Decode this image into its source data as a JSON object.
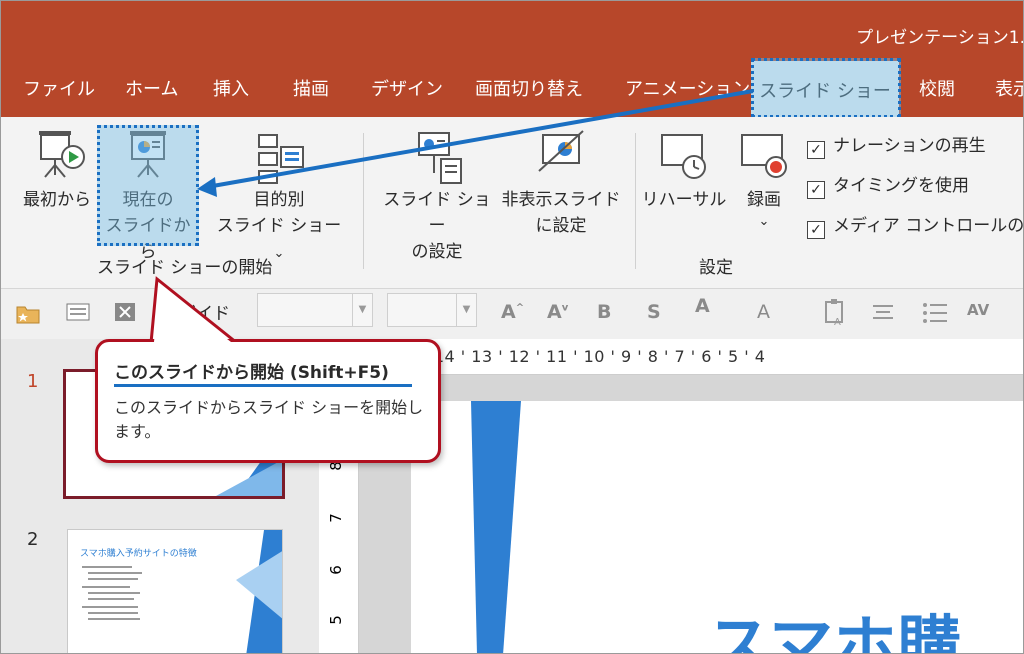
{
  "app": {
    "title": "プレゼンテーション1."
  },
  "tabs": [
    "ファイル",
    "ホーム",
    "挿入",
    "描画",
    "デザイン",
    "画面切り替え",
    "アニメーション",
    "スライド ショー",
    "校閲",
    "表示"
  ],
  "active_tab": "スライド ショー",
  "ribbon": {
    "start_group": {
      "label": "スライド ショーの開始",
      "from_beginning": "最初から",
      "from_current_line1": "現在の",
      "from_current_line2": "スライドから",
      "custom_line1": "目的別",
      "custom_line2": "スライド ショー",
      "custom_caret": "⌄"
    },
    "setup_group": {
      "label": "設定",
      "setup_line1": "スライド ショー",
      "setup_line2": "の設定",
      "hide_line1": "非表示スライド",
      "hide_line2": "に設定",
      "rehearse": "リハーサル",
      "record": "録画",
      "record_caret": "⌄",
      "checkboxes": [
        {
          "label": "ナレーションの再生",
          "checked": true
        },
        {
          "label": "タイミングを使用",
          "checked": true
        },
        {
          "label": "メディア コントロールの表",
          "checked": true
        }
      ]
    }
  },
  "toolbar": {
    "guide_label": "ガイド",
    "guide_checked": true
  },
  "slides_panel": {
    "numbers": [
      "1",
      "2"
    ],
    "thumb2_title": "スマホ購入予約サイトの特徴"
  },
  "ruler": {
    "horizontal": "16 ' 15 ' 14 ' 13 ' 12 ' 11 ' 10 ' 9 ' 8 ' 7 ' 6 ' 5 ' 4",
    "vertical": [
      "8",
      "7",
      "6",
      "5"
    ]
  },
  "slide_text": "スマホ購",
  "tooltip": {
    "title": "このスライドから開始 (Shift+F5)",
    "description": "このスライドからスライド ショーを開始します。"
  },
  "colors": {
    "accent": "#b7472a",
    "highlight": "#1a6fc2",
    "callout_border": "#b01020",
    "slide_blue": "#2e7fd2"
  }
}
